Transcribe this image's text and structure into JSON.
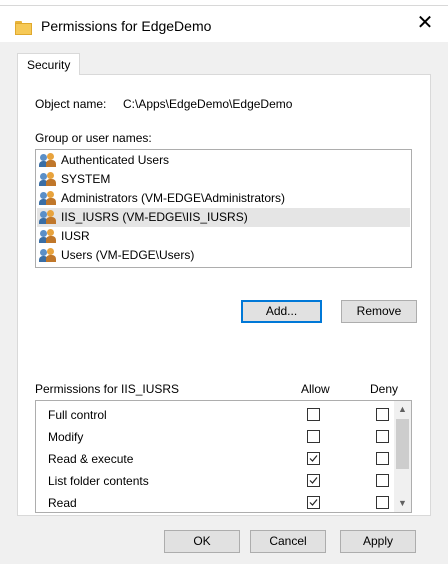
{
  "window": {
    "title": "Permissions for EdgeDemo",
    "close_symbol": "✕"
  },
  "tabs": [
    {
      "label": "Security"
    }
  ],
  "object": {
    "label": "Object name:",
    "value": "C:\\Apps\\EdgeDemo\\EdgeDemo"
  },
  "group_label": "Group or user names:",
  "users": [
    {
      "name": "Authenticated Users"
    },
    {
      "name": "SYSTEM"
    },
    {
      "name": "Administrators (VM-EDGE\\Administrators)"
    },
    {
      "name": "IIS_IUSRS (VM-EDGE\\IIS_IUSRS)"
    },
    {
      "name": "IUSR"
    },
    {
      "name": "Users (VM-EDGE\\Users)"
    }
  ],
  "selected_user_index": 3,
  "buttons": {
    "add": "Add...",
    "remove": "Remove",
    "ok": "OK",
    "cancel": "Cancel",
    "apply": "Apply"
  },
  "permissions": {
    "header": "Permissions for IIS_IUSRS",
    "allow_label": "Allow",
    "deny_label": "Deny",
    "rows": [
      {
        "name": "Full control",
        "allow": false,
        "deny": false
      },
      {
        "name": "Modify",
        "allow": false,
        "deny": false
      },
      {
        "name": "Read & execute",
        "allow": true,
        "deny": false
      },
      {
        "name": "List folder contents",
        "allow": true,
        "deny": false
      },
      {
        "name": "Read",
        "allow": true,
        "deny": false
      }
    ]
  },
  "colors": {
    "accent": "#0078d7",
    "selection": "#e5e5e5",
    "folder": "#f6c957"
  }
}
